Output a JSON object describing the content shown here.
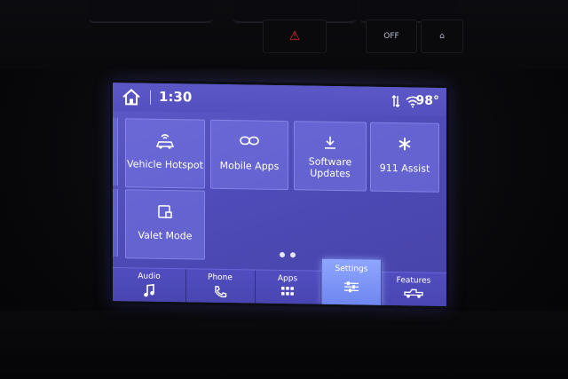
{
  "status_bar": {
    "time": "1:30",
    "temperature": "98°",
    "home_icon": "home-icon",
    "signal_icon": "signal-icon",
    "wifi_icon": "wifi-icon"
  },
  "dash_controls": {
    "hazard_icon": "hazard-icon",
    "traction_label": "OFF"
  },
  "tiles": [
    {
      "label": "Vehicle Hotspot",
      "icon": "hotspot-icon"
    },
    {
      "label": "Mobile Apps",
      "icon": "link-icon"
    },
    {
      "label": "Software Updates",
      "line1": "Software",
      "line2": "Updates",
      "icon": "download-icon"
    },
    {
      "label": "911 Assist",
      "icon": "assist-icon"
    },
    {
      "label": "Valet Mode",
      "icon": "valet-icon"
    }
  ],
  "pagination": {
    "pages": 2,
    "current": 1
  },
  "tabs": [
    {
      "label": "Audio",
      "icon": "music-note-icon"
    },
    {
      "label": "Phone",
      "icon": "phone-icon"
    },
    {
      "label": "Apps",
      "icon": "grid-icon"
    },
    {
      "label": "Settings",
      "icon": "sliders-icon",
      "active": true
    },
    {
      "label": "Features",
      "icon": "truck-icon"
    }
  ],
  "colors": {
    "screen_bg": "#5e5ac8",
    "tile_bg": "#7878e6",
    "active_tab": "#8fa6ff",
    "hazard": "#e23030"
  }
}
